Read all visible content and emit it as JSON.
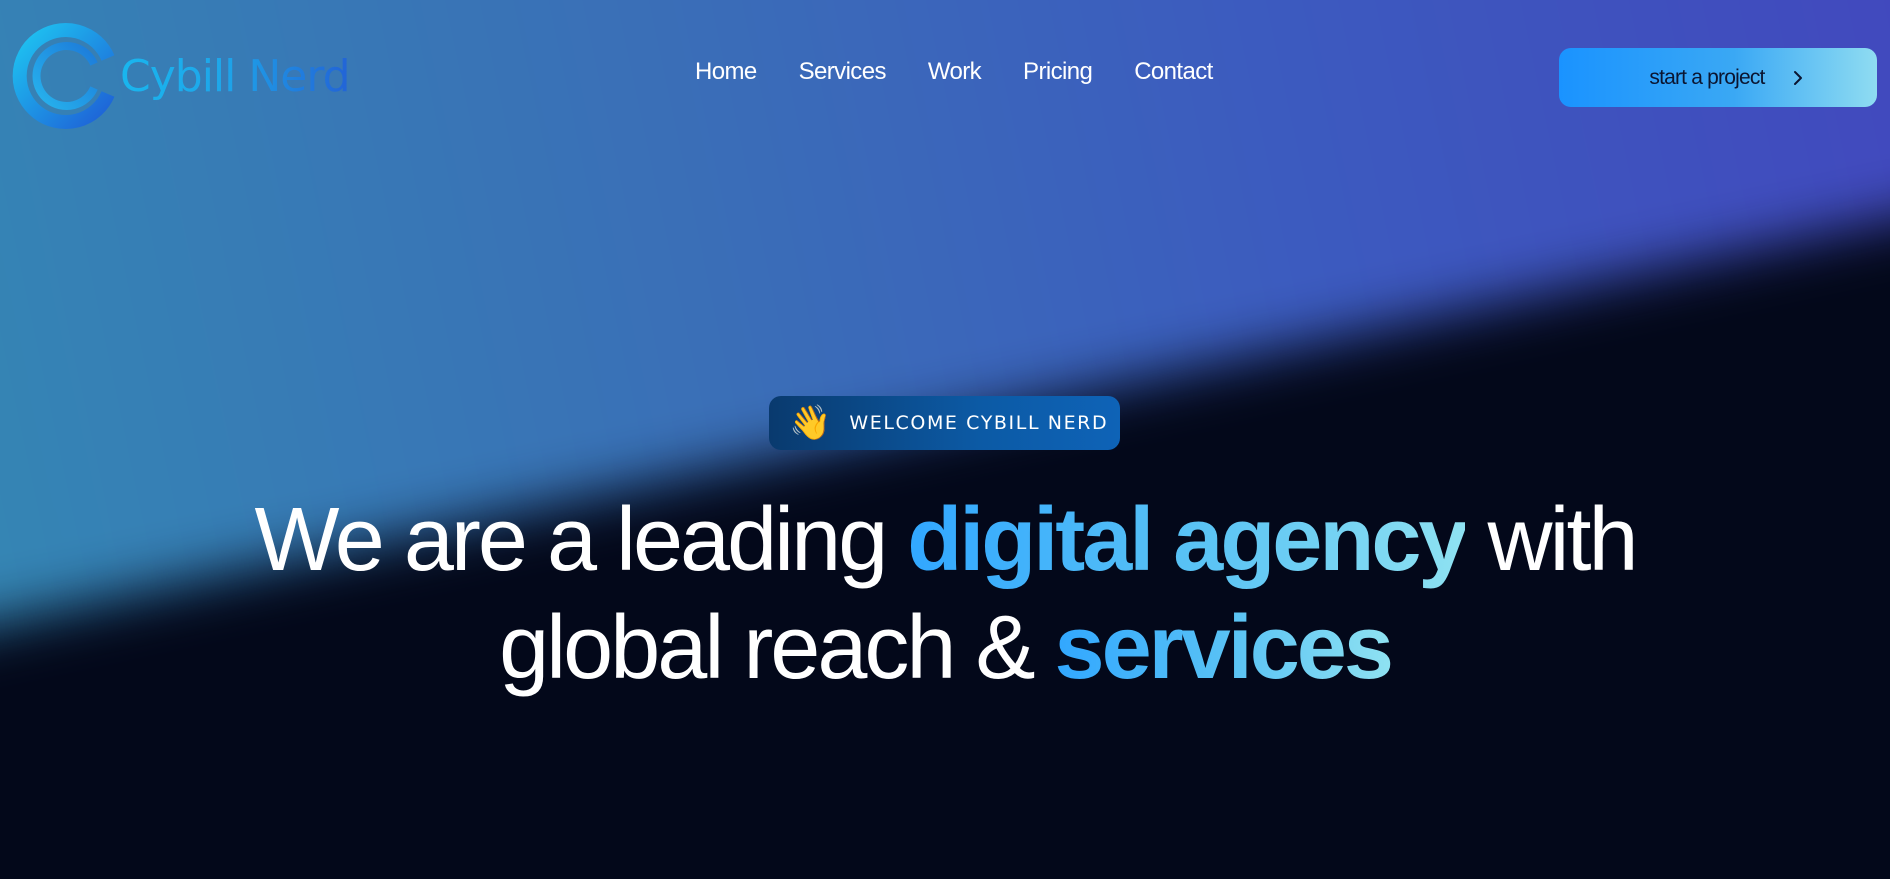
{
  "brand": {
    "name": "Cybill Nerd",
    "logo_icon": "ring-logo-icon"
  },
  "nav": {
    "items": [
      {
        "label": "Home"
      },
      {
        "label": "Services"
      },
      {
        "label": "Work"
      },
      {
        "label": "Pricing"
      },
      {
        "label": "Contact"
      }
    ]
  },
  "cta": {
    "label": "start a project",
    "icon": "chevron-right-icon"
  },
  "badge": {
    "icon": "👋",
    "label": "WELCOME CYBILL NERD"
  },
  "headline": {
    "part1": "We are a leading ",
    "accent1": "digital agency",
    "part2": " with",
    "part3": "global reach & ",
    "accent2": "services"
  },
  "colors": {
    "background": "#03081a",
    "accent": "#31a7ff",
    "accent_light": "#8fe2f2",
    "badge": "#0c5aa5",
    "text": "#ffffff"
  }
}
